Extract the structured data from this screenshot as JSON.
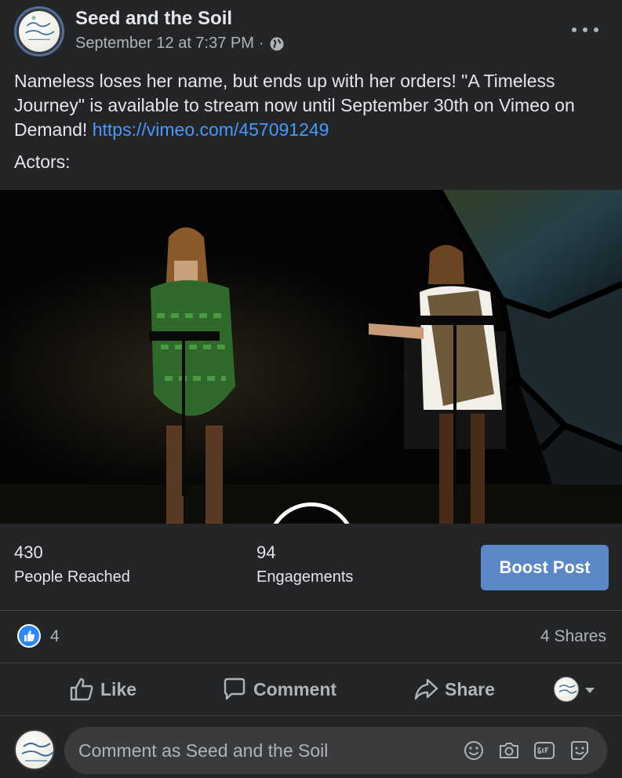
{
  "post": {
    "page_name": "Seed and the Soil",
    "timestamp": "September 12 at 7:37 PM",
    "separator": "·",
    "caption_text": "Nameless loses her name, but ends up with her orders!  \"A Timeless Journey\" is available to stream now until September 30th on Vimeo on Demand! ",
    "caption_link": "https://vimeo.com/457091249",
    "actors_label": "Actors:"
  },
  "insights": {
    "reached_value": "430",
    "reached_label": "People Reached",
    "engagements_value": "94",
    "engagements_label": "Engagements",
    "boost_label": "Boost Post"
  },
  "reactions": {
    "like_count": "4",
    "shares_label": "4 Shares"
  },
  "actions": {
    "like_label": "Like",
    "comment_label": "Comment",
    "share_label": "Share"
  },
  "composer": {
    "placeholder": "Comment as Seed and the Soil"
  },
  "colors": {
    "background": "#242526",
    "link": "#4599ff",
    "boost": "#5b87c7",
    "like_badge": "#2d88ff"
  }
}
